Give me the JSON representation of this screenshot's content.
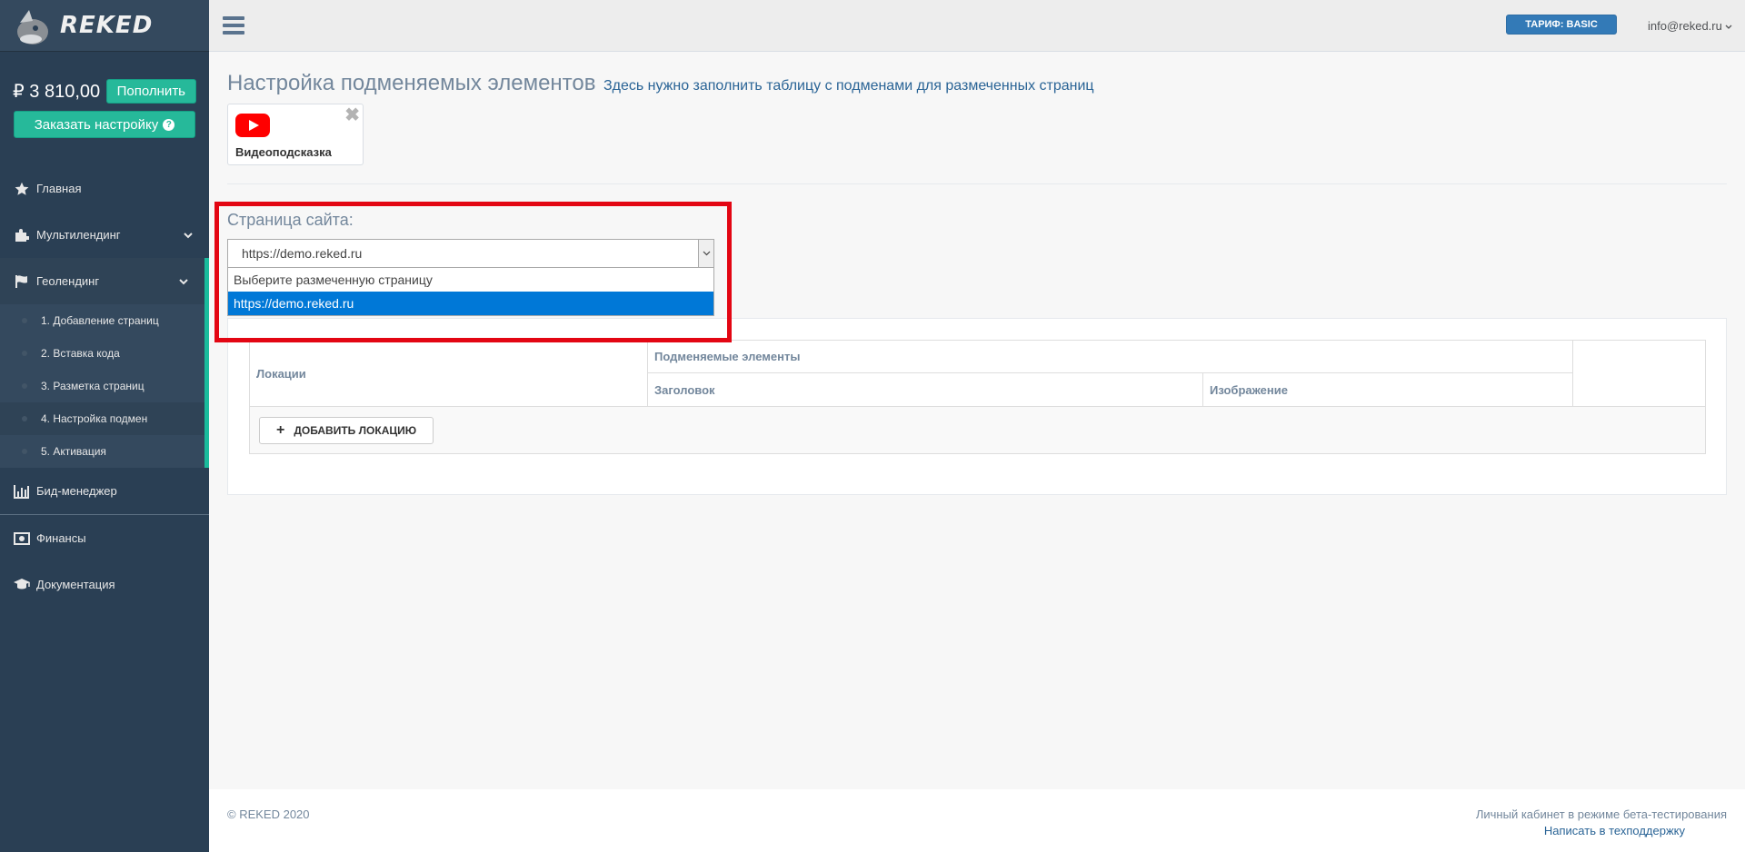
{
  "sidebar": {
    "brand": "REKED",
    "balance": "₽ 3 810,00",
    "topup_label": "Пополнить",
    "order_setup_label": "Заказать настройку",
    "order_setup_help": "?",
    "menu": {
      "home": "Главная",
      "multilanding": "Мультилендинг",
      "geolanding": "Геолендинг",
      "geo_sub": [
        "1. Добавление страниц",
        "2. Вставка кода",
        "3. Разметка страниц",
        "4. Настройка подмен",
        "5. Активация"
      ],
      "bid_manager": "Бид-менеджер",
      "finance": "Финансы",
      "docs": "Документация"
    }
  },
  "topnav": {
    "tariff": "ТАРИФ: BASIC",
    "user": "info@reked.ru"
  },
  "main": {
    "title": "Настройка подменяемых элементов",
    "subtitle": "Здесь нужно заполнить таблицу с подменами для размеченных страниц",
    "video_hint": "Видеоподсказка",
    "page_label": "Страница сайта:",
    "select_value": "https://demo.reked.ru",
    "options": [
      "Выберите размеченную страницу",
      "https://demo.reked.ru"
    ],
    "table": {
      "locations": "Локации",
      "replaced": "Подменяемые элементы",
      "heading": "Заголовок",
      "image": "Изображение"
    },
    "add_location": "ДОБАВИТЬ ЛОКАЦИЮ"
  },
  "footer": {
    "copyright": "© REKED 2020",
    "beta": "Личный кабинет в режиме бета-тестирования",
    "support": "Написать в техподдержку"
  },
  "colors": {
    "sidebar_bg": "#2a3f54",
    "accent_green": "#26b99a",
    "tariff_blue": "#337ab7",
    "highlight_red": "#e30613",
    "selected_option": "#0078d7"
  }
}
